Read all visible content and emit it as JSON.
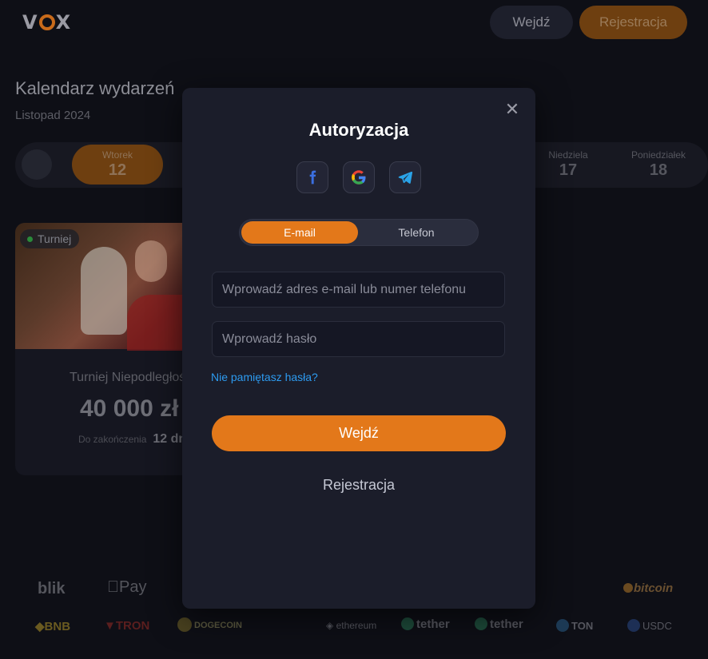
{
  "header": {
    "logo_text": "VOX",
    "login_label": "Wejdź",
    "register_label": "Rejestracja"
  },
  "background": {
    "title": "Kalendarz wydarzeń",
    "subtitle": "Listopad 2024",
    "days": [
      {
        "name": "Wtorek",
        "date": "12",
        "active": true
      },
      {
        "name": "Niedziela",
        "date": "17"
      },
      {
        "name": "Poniedziałek",
        "date": "18"
      }
    ],
    "card": {
      "badge": "Turniej",
      "title": "Turniej Niepodległoś",
      "amount": "40 000 zł",
      "ends_label": "Do zakończenia",
      "ends_value": "12 dn"
    },
    "payments_row1": [
      "blik",
      "Pay",
      "bitcoin"
    ],
    "payments_row2": [
      "BNB",
      "TRON",
      "DOGECOIN",
      "ethereum",
      "tether",
      "tether",
      "TON",
      "USDC"
    ]
  },
  "modal": {
    "title": "Autoryzacja",
    "social": [
      "facebook-icon",
      "google-icon",
      "telegram-icon"
    ],
    "tabs": {
      "email": "E-mail",
      "phone": "Telefon"
    },
    "email_placeholder": "Wprowadź adres e-mail lub numer telefonu",
    "password_placeholder": "Wprowadź hasło",
    "forgot_label": "Nie pamiętasz hasła?",
    "submit_label": "Wejdź",
    "register_label": "Rejestracja"
  },
  "colors": {
    "accent": "#e3781a",
    "link": "#2d9bf0",
    "modal_bg": "#1b1d2a"
  }
}
